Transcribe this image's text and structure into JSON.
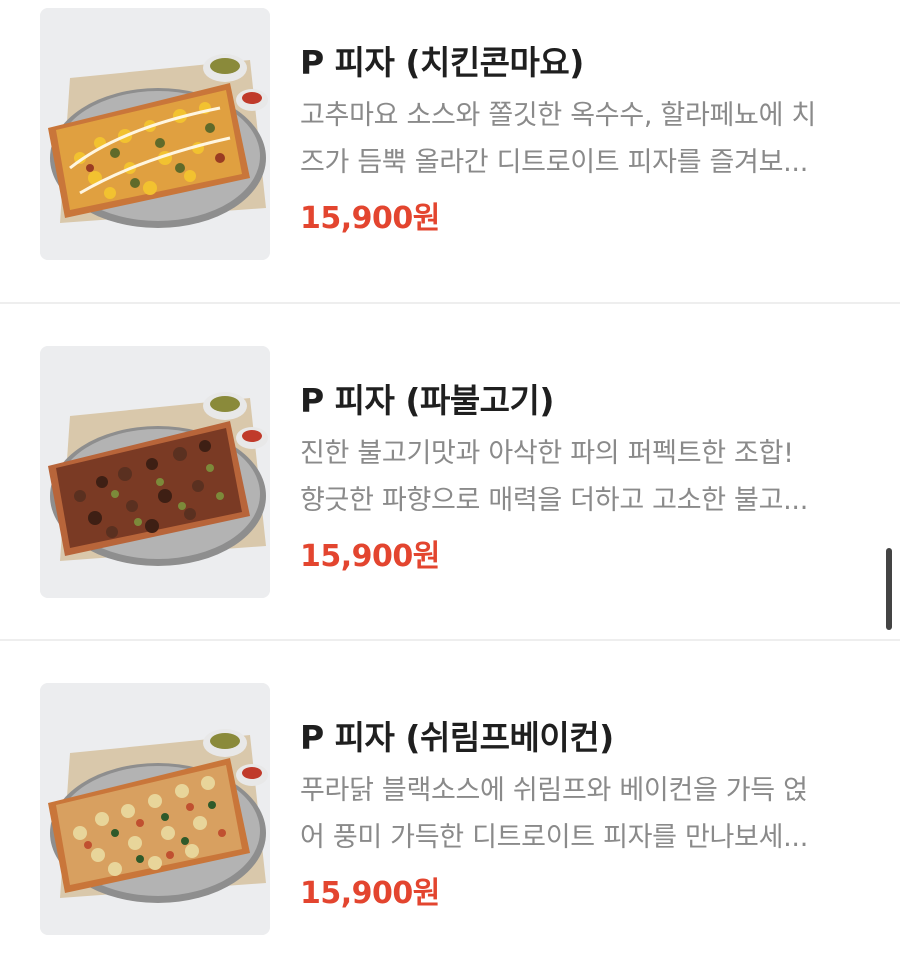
{
  "menu": {
    "items": [
      {
        "name": "P 피자 (치킨콘마요)",
        "description_line1": "고추마요 소스와 쫄깃한 옥수수, 할라페뇨에 치",
        "description_line2": "즈가 듬뿍 올라간 디트로이트 피자를 즐겨보...",
        "price": "15,900원",
        "image_icon": "chicken-corn-mayo-pizza-image",
        "topping_colors": [
          "#f2c230",
          "#5f6a2a",
          "#9a3c22"
        ]
      },
      {
        "name": "P 피자 (파불고기)",
        "description_line1": "진한 불고기맛과 아삭한 파의 퍼펙트한 조합!",
        "description_line2": "향긋한 파향으로 매력을 더하고 고소한 불고...",
        "price": "15,900원",
        "image_icon": "green-onion-bulgogi-pizza-image",
        "topping_colors": [
          "#5a3020",
          "#3e1f14",
          "#7c8a3a"
        ]
      },
      {
        "name": "P 피자 (쉬림프베이컨)",
        "description_line1": "푸라닭 블랙소스에 쉬림프와 베이컨을 가득 얹",
        "description_line2": "어 풍미 가득한 디트로이트 피자를 만나보세...",
        "price": "15,900원",
        "image_icon": "shrimp-bacon-pizza-image",
        "topping_colors": [
          "#e8d59a",
          "#2f5a2a",
          "#c05030"
        ]
      }
    ]
  },
  "colors": {
    "price": "#e3452f",
    "title": "#1f1f1f",
    "description": "#8a8a8a",
    "divider": "#eeeeee",
    "thumb_background": "#ecedef"
  }
}
